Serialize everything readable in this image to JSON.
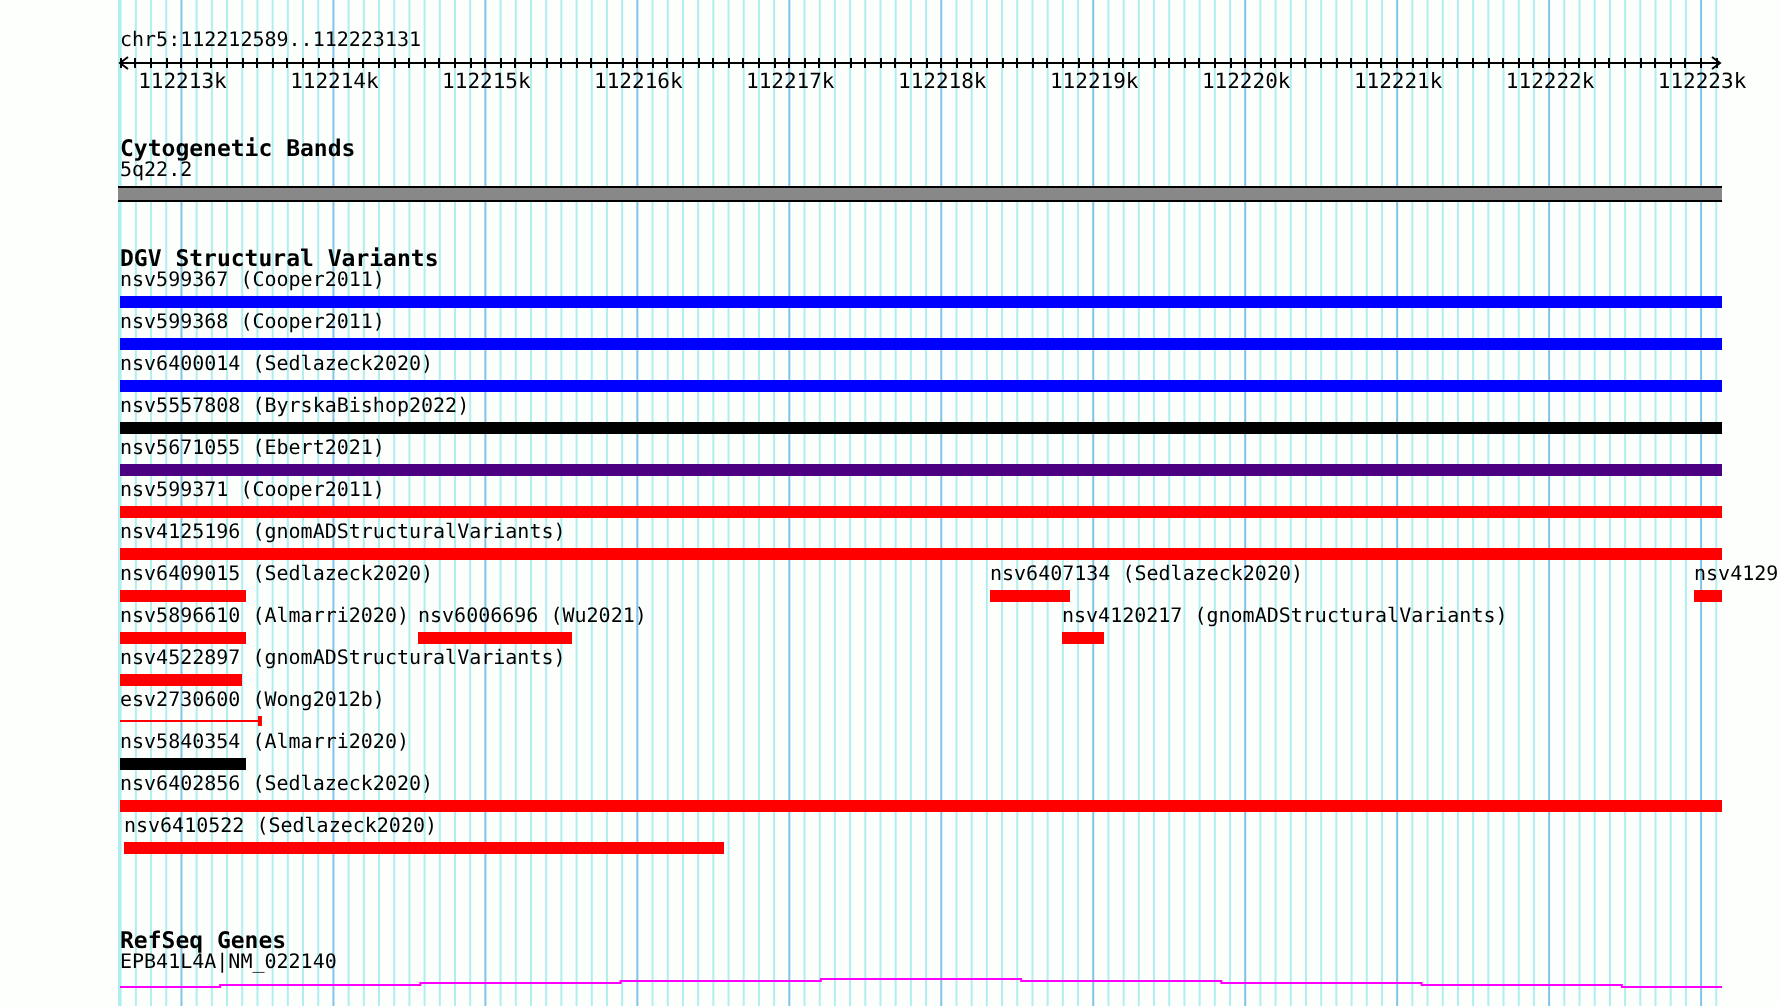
{
  "view": {
    "locus": "chr5:112212589..112223131"
  },
  "ruler": {
    "ticks": [
      "112213k",
      "112214k",
      "112215k",
      "112216k",
      "112217k",
      "112218k",
      "112219k",
      "112220k",
      "112221k",
      "112222k",
      "112223k"
    ]
  },
  "cytoband_track": {
    "title": "Cytogenetic Bands",
    "band": "5q22.2"
  },
  "dgv_track": {
    "title": "DGV Structural Variants",
    "rows": [
      {
        "features": [
          {
            "label": "nsv599367 (Cooper2011)",
            "kind": "bar",
            "color": "#0000ff"
          }
        ]
      },
      {
        "features": [
          {
            "label": "nsv599368 (Cooper2011)",
            "kind": "bar",
            "color": "#0000ff"
          }
        ]
      },
      {
        "features": [
          {
            "label": "nsv6400014 (Sedlazeck2020)",
            "kind": "bar",
            "color": "#0000ff"
          }
        ]
      },
      {
        "features": [
          {
            "label": "nsv5557808 (ByrskaBishop2022)",
            "kind": "bar",
            "color": "#000000"
          }
        ]
      },
      {
        "features": [
          {
            "label": "nsv5671055 (Ebert2021)",
            "kind": "bar",
            "color": "#4b0082"
          }
        ]
      },
      {
        "features": [
          {
            "label": "nsv599371 (Cooper2011)",
            "kind": "bar",
            "color": "#ff0000"
          }
        ]
      },
      {
        "features": [
          {
            "label": "nsv4125196 (gnomADStructuralVariants)",
            "kind": "bar",
            "color": "#ff0000"
          }
        ]
      },
      {
        "features": [
          {
            "label": "nsv6409015 (Sedlazeck2020)",
            "kind": "bar",
            "color": "#ff0000"
          },
          {
            "label": "nsv6407134 (Sedlazeck2020)",
            "kind": "bar",
            "color": "#ff0000"
          },
          {
            "label": "nsv4129",
            "kind": "bar",
            "color": "#ff0000"
          }
        ]
      },
      {
        "features": [
          {
            "label": "nsv5896610 (Almarri2020)",
            "kind": "bar",
            "color": "#ff0000"
          },
          {
            "label": "nsv6006696 (Wu2021)",
            "kind": "bar",
            "color": "#ff0000"
          },
          {
            "label": "nsv4120217 (gnomADStructuralVariants)",
            "kind": "bar",
            "color": "#ff0000"
          }
        ]
      },
      {
        "features": [
          {
            "label": "nsv4522897 (gnomADStructuralVariants)",
            "kind": "bar",
            "color": "#ff0000"
          }
        ]
      },
      {
        "features": [
          {
            "label": "esv2730600 (Wong2012b)",
            "kind": "line",
            "color": "#ff0000"
          }
        ]
      },
      {
        "features": [
          {
            "label": "nsv5840354 (Almarri2020)",
            "kind": "bar",
            "color": "#000000"
          }
        ]
      },
      {
        "features": [
          {
            "label": "nsv6402856 (Sedlazeck2020)",
            "kind": "bar",
            "color": "#ff0000"
          }
        ]
      },
      {
        "features": [
          {
            "label": "nsv6410522 (Sedlazeck2020)",
            "kind": "bar",
            "color": "#ff0000"
          }
        ]
      }
    ]
  },
  "refseq_track": {
    "title": "RefSeq Genes",
    "genes": [
      {
        "label": "EPB41L4A|NM_022140"
      }
    ]
  }
}
